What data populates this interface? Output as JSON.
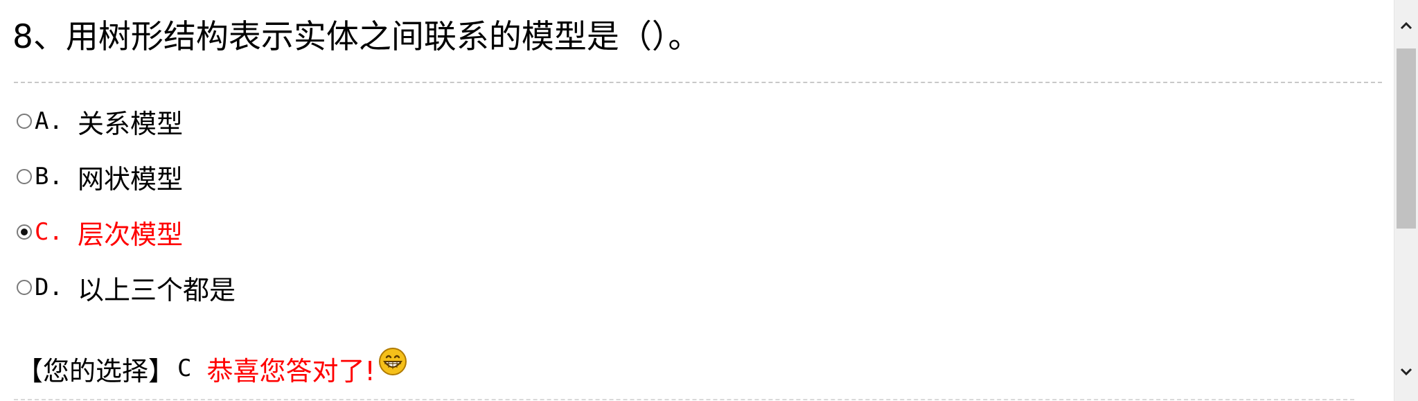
{
  "question": {
    "title": "8、用树形结构表示实体之间联系的模型是（）。"
  },
  "options": [
    {
      "letter": "A.",
      "text": "关系模型",
      "selected": false,
      "correct": false
    },
    {
      "letter": "B.",
      "text": "网状模型",
      "selected": false,
      "correct": false
    },
    {
      "letter": "C.",
      "text": "层次模型",
      "selected": true,
      "correct": true
    },
    {
      "letter": "D.",
      "text": "以上三个都是",
      "selected": false,
      "correct": false
    }
  ],
  "result": {
    "label": "【您的选择】",
    "choice": "C",
    "feedback": "恭喜您答对了!",
    "feedback_icon": "grinning-smiley-icon"
  },
  "colors": {
    "correct": "#ff0000",
    "divider": "#c8c8c8",
    "scrollbar_track": "#f0f0f0",
    "scrollbar_thumb": "#c1c1c1",
    "smiley_face": "#f5c01a"
  },
  "scrollbar": {
    "up_icon": "chevron-up-icon",
    "down_icon": "chevron-down-icon"
  }
}
